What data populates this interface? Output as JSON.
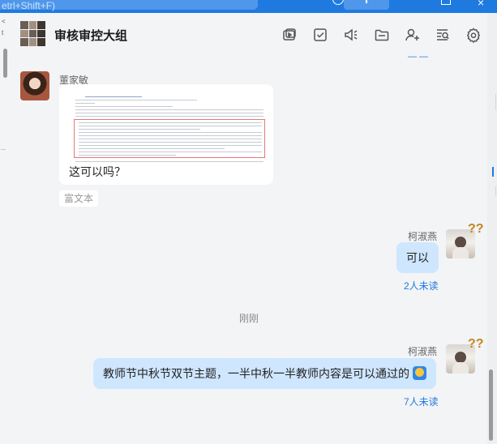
{
  "window": {
    "search_placeholder": "etrl+Shift+F)",
    "close_glyph": "×"
  },
  "header": {
    "group_name": "审核审控大组",
    "icons": [
      "screen-share-icon",
      "task-check-icon",
      "announcement-icon",
      "folder-icon",
      "add-member-icon",
      "search-history-icon",
      "settings-icon"
    ]
  },
  "leftstrip": {
    "chars": [
      "<",
      "t",
      "g",
      "+",
      "1"
    ]
  },
  "messages": [
    {
      "sender": "董家敏",
      "type": "rich_text",
      "caption": "这可以吗？",
      "tag": "富文本"
    },
    {
      "sender": "柯淑燕",
      "text": "可以",
      "unread": "2人未读"
    },
    {
      "sender": "柯淑燕",
      "text": "教师节中秋节双节主题，一半中秋一半教师内容是可以通过的",
      "emoji": "face-with-raised-hand-emoji",
      "unread": "7人未读"
    }
  ],
  "time_separator": "刚刚",
  "colors": {
    "accent": "#1f7ae0",
    "bubble_out": "#cfe6ff",
    "background": "#f3f4f6"
  }
}
